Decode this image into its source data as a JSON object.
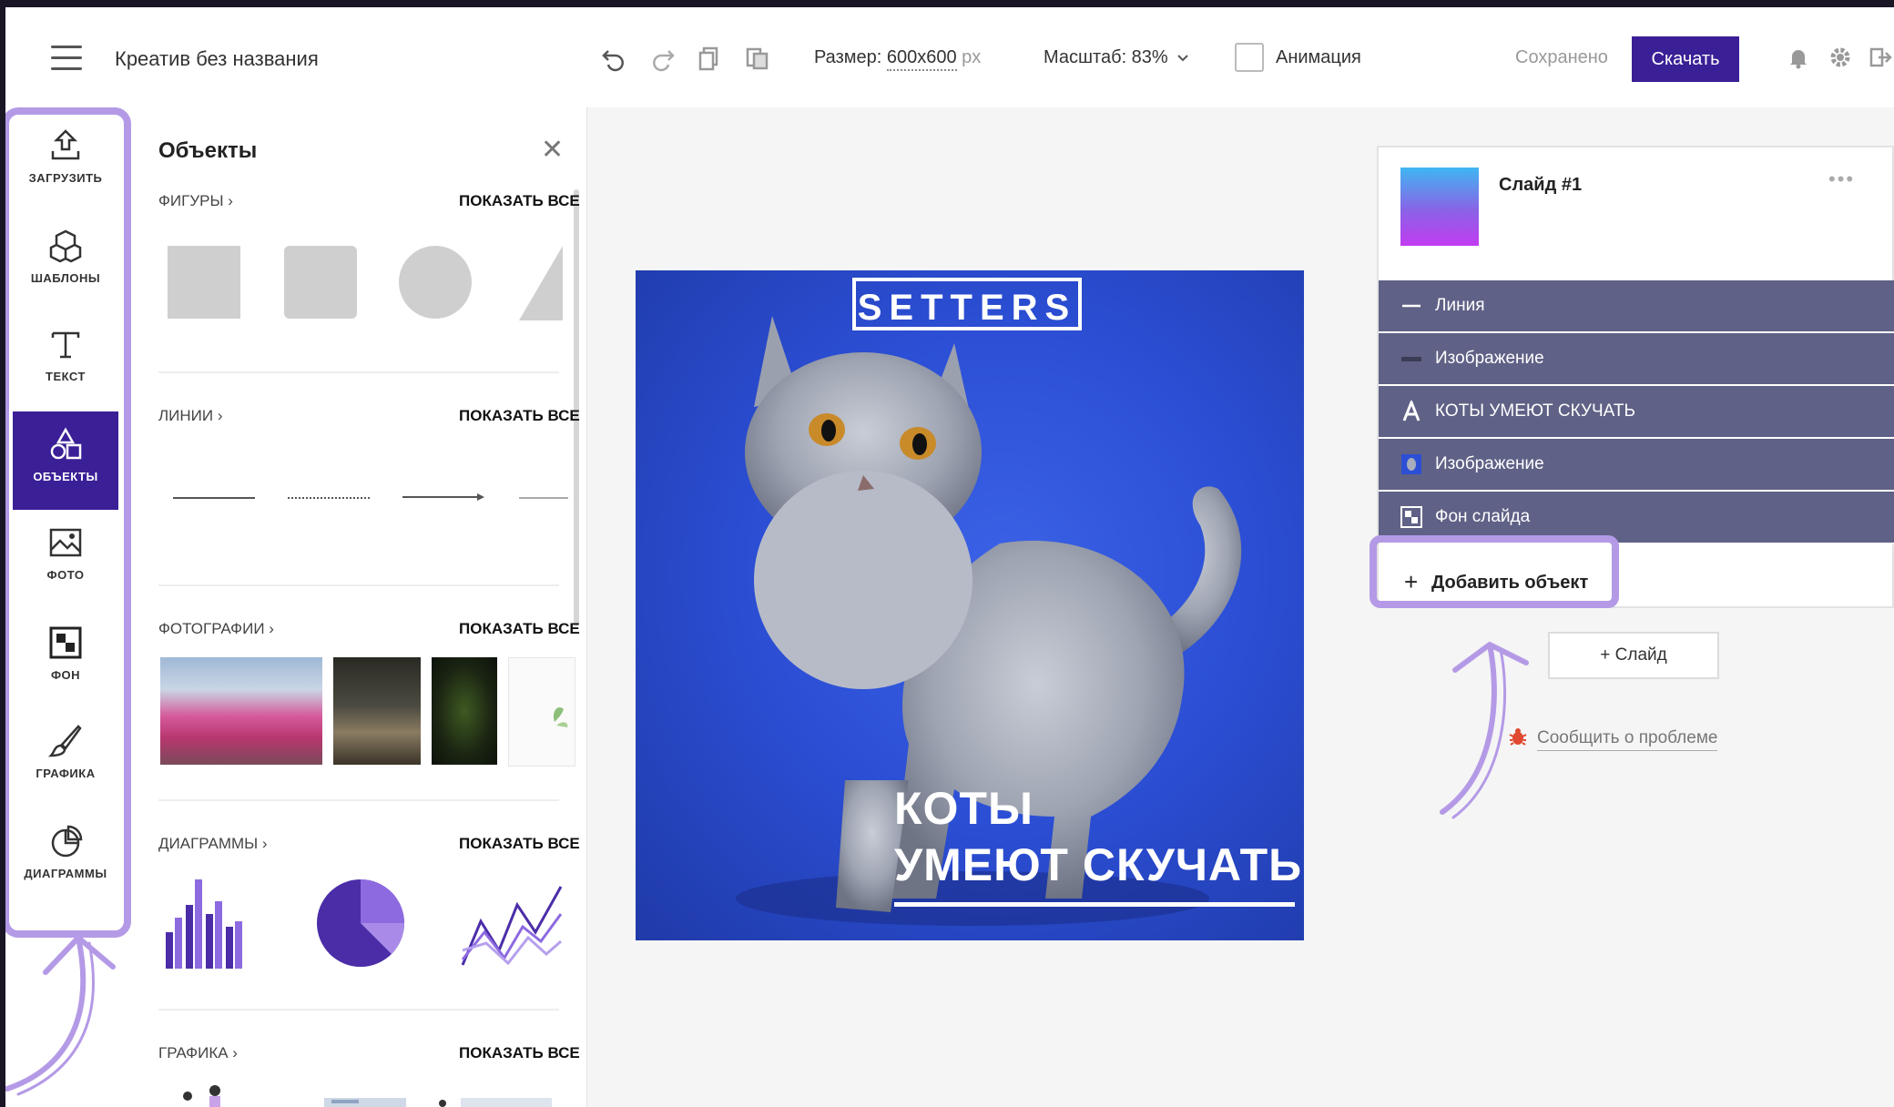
{
  "topbar": {
    "title": "Креатив без названия",
    "size_label": "Размер:",
    "size_value": "600x600",
    "size_unit": "px",
    "zoom": "Масштаб: 83%",
    "animation_label": "Анимация",
    "saved_status": "Сохранено",
    "download_label": "Скачать",
    "icons": [
      "menu-icon",
      "undo-icon",
      "redo-icon",
      "copy-icon",
      "paste-icon",
      "bell-icon",
      "gear-icon",
      "logout-icon"
    ]
  },
  "sidebar": {
    "items": [
      {
        "label": "ЗАГРУЗИТЬ",
        "icon": "upload-icon"
      },
      {
        "label": "ШАБЛОНЫ",
        "icon": "templates-icon"
      },
      {
        "label": "ТЕКСТ",
        "icon": "text-icon"
      },
      {
        "label": "ОБЪЕКТЫ",
        "icon": "objects-icon",
        "active": true
      },
      {
        "label": "ФОТО",
        "icon": "photo-icon"
      },
      {
        "label": "ФОН",
        "icon": "background-icon"
      },
      {
        "label": "ГРАФИКА",
        "icon": "brush-icon"
      },
      {
        "label": "ДИАГРАММЫ",
        "icon": "chart-icon"
      }
    ]
  },
  "objects_panel": {
    "title": "Объекты",
    "show_all": "ПОКАЗАТЬ ВСЕ",
    "sections": [
      {
        "label": "ФИГУРЫ ›"
      },
      {
        "label": "ЛИНИИ ›"
      },
      {
        "label": "ФОТОГРАФИИ ›"
      },
      {
        "label": "ДИАГРАММЫ ›"
      },
      {
        "label": "ГРАФИКА ›"
      }
    ]
  },
  "canvas": {
    "brand": "SETTERS",
    "headline_line1": "КОТЫ",
    "headline_line2": "УМЕЮТ СКУЧАТЬ",
    "background_color": "#2c4fd6"
  },
  "slides_panel": {
    "slide_name": "Слайд #1",
    "more": "•••",
    "layers": [
      {
        "label": "Линия",
        "icon": "line-icon"
      },
      {
        "label": "Изображение",
        "icon": "image-line-icon"
      },
      {
        "label": "КОТЫ УМЕЮТ СКУЧАТЬ",
        "icon": "text-a-icon"
      },
      {
        "label": "Изображение",
        "icon": "image-thumb-icon"
      },
      {
        "label": "Фон слайда",
        "icon": "slide-background-icon"
      }
    ],
    "add_object": "Добавить объект",
    "add_slide": "+ Слайд",
    "report_problem": "Сообщить о проблеме"
  },
  "colors": {
    "accent": "#3a1f96",
    "highlight": "#b49ae6",
    "layer_bg": "#5f6186"
  }
}
